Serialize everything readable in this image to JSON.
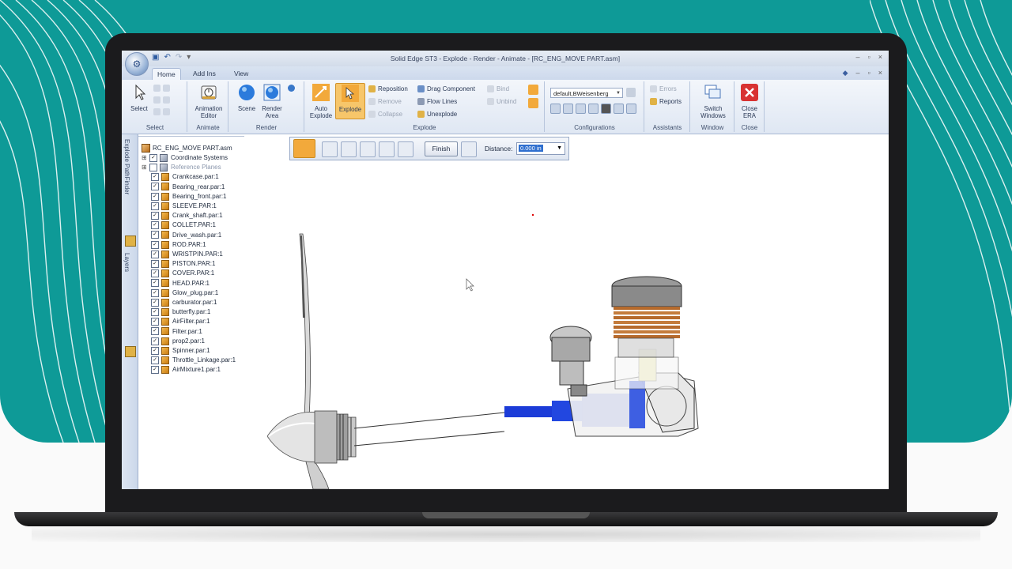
{
  "window": {
    "title": "Solid Edge ST3 - Explode - Render - Animate - [RC_ENG_MOVE PART.asm]"
  },
  "tabs": [
    {
      "label": "Home",
      "active": true
    },
    {
      "label": "Add Ins",
      "active": false
    },
    {
      "label": "View",
      "active": false
    }
  ],
  "ribbon": {
    "groups": {
      "select": "Select",
      "animate": "Animate",
      "render": "Render",
      "explode": "Explode",
      "configurations": "Configurations",
      "assistants": "Assistants",
      "window": "Window",
      "close": "Close"
    },
    "buttons": {
      "select": "Select",
      "animation_editor": "Animation Editor",
      "scene": "Scene",
      "render_area": "Render Area",
      "auto_explode": "Auto Explode",
      "explode": "Explode",
      "reposition": "Reposition",
      "remove": "Remove",
      "collapse": "Collapse",
      "drag_component": "Drag Component",
      "flow_lines": "Flow Lines",
      "unexplode": "Unexplode",
      "bind": "Bind",
      "unbind": "Unbind",
      "errors": "Errors",
      "reports": "Reports",
      "switch_windows": "Switch Windows",
      "close_era": "Close ERA"
    },
    "configuration_value": "default,BWeisenberg"
  },
  "sidebar": {
    "tabs": [
      "Explode PathFinder",
      "Layers"
    ]
  },
  "tree": {
    "root": "RC_ENG_MOVE PART.asm",
    "items": [
      {
        "label": "Coordinate Systems",
        "checked": true,
        "expandable": true
      },
      {
        "label": "Reference Planes",
        "checked": false,
        "expandable": true,
        "faded": true
      },
      {
        "label": "Crankcase.par:1",
        "checked": true
      },
      {
        "label": "Bearing_rear.par:1",
        "checked": true
      },
      {
        "label": "Bearing_front.par:1",
        "checked": true
      },
      {
        "label": "SLEEVE.PAR:1",
        "checked": true
      },
      {
        "label": "Crank_shaft.par:1",
        "checked": true
      },
      {
        "label": "COLLET.PAR:1",
        "checked": true
      },
      {
        "label": "Drive_wash.par:1",
        "checked": true
      },
      {
        "label": "ROD.PAR:1",
        "checked": true
      },
      {
        "label": "WRISTPIN.PAR:1",
        "checked": true
      },
      {
        "label": "PISTON.PAR:1",
        "checked": true
      },
      {
        "label": "COVER.PAR:1",
        "checked": true
      },
      {
        "label": "HEAD.PAR:1",
        "checked": true
      },
      {
        "label": "Glow_plug.par:1",
        "checked": true
      },
      {
        "label": "carburator.par:1",
        "checked": true
      },
      {
        "label": "butterfly.par:1",
        "checked": true
      },
      {
        "label": "AirFilter.par:1",
        "checked": true
      },
      {
        "label": "Filter.par:1",
        "checked": true
      },
      {
        "label": "prop2.par:1",
        "checked": true
      },
      {
        "label": "Spinner.par:1",
        "checked": true
      },
      {
        "label": "Throttle_Linkage.par:1",
        "checked": true
      },
      {
        "label": "AirMixture1.par:1",
        "checked": true
      }
    ]
  },
  "explode_bar": {
    "finish_label": "Finish",
    "distance_label": "Distance:",
    "distance_value": "0.000 in"
  },
  "colors": {
    "teal": "#0e9a97",
    "accent_orange": "#f2a93b",
    "ribbon_blue": "#dfe7f3",
    "highlight_blue": "#1c3cd8"
  }
}
